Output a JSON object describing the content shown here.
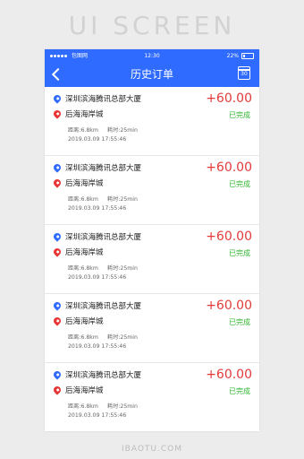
{
  "banner": {
    "title": "UI SCREEN"
  },
  "statusbar": {
    "carrier": "包图网",
    "time": "12:30",
    "battery": "22%"
  },
  "navbar": {
    "title": "历史订单",
    "calendar_day": "30"
  },
  "orders": [
    {
      "from": "深圳滨海腾讯总部大厦",
      "to": "后海海岸城",
      "distance": "距离:6.8km",
      "duration": "耗时:25min",
      "datetime": "2019.03.09 17:55:46",
      "amount": "+60.00",
      "status": "已完成"
    },
    {
      "from": "深圳滨海腾讯总部大厦",
      "to": "后海海岸城",
      "distance": "距离:6.8km",
      "duration": "耗时:25min",
      "datetime": "2019.03.09 17:55:46",
      "amount": "+60.00",
      "status": "已完成"
    },
    {
      "from": "深圳滨海腾讯总部大厦",
      "to": "后海海岸城",
      "distance": "距离:6.8km",
      "duration": "耗时:25min",
      "datetime": "2019.03.09 17:55:46",
      "amount": "+60.00",
      "status": "已完成"
    },
    {
      "from": "深圳滨海腾讯总部大厦",
      "to": "后海海岸城",
      "distance": "距离:6.8km",
      "duration": "耗时:25min",
      "datetime": "2019.03.09 17:55:46",
      "amount": "+60.00",
      "status": "已完成"
    },
    {
      "from": "深圳滨海腾讯总部大厦",
      "to": "后海海岸城",
      "distance": "距离:6.8km",
      "duration": "耗时:25min",
      "datetime": "2019.03.09 17:55:46",
      "amount": "+60.00",
      "status": "已完成"
    }
  ],
  "watermark": "IBAOTU.COM",
  "colors": {
    "primary": "#2f6bff",
    "amount": "#e33a3a",
    "status": "#2fb52f",
    "origin_pin": "#2f6bff",
    "destination_pin": "#e83535"
  }
}
